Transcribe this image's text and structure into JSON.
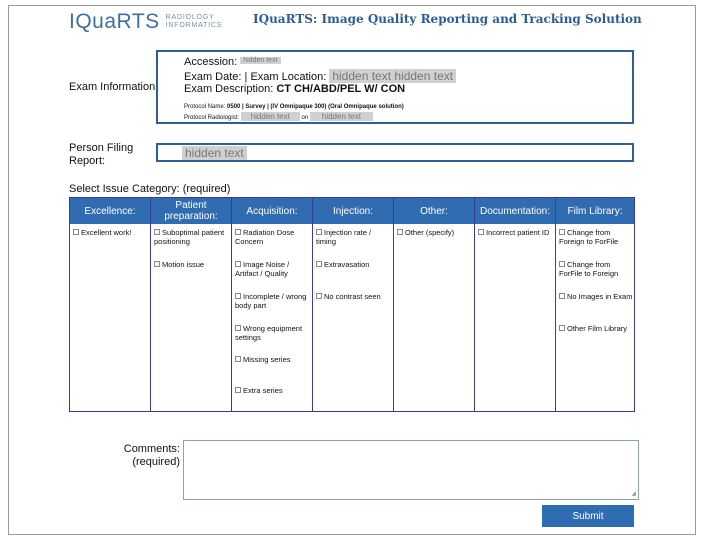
{
  "header": {
    "logo_main": "IQuaRTS",
    "logo_sub_line1": "RADIOLOGY",
    "logo_sub_line2": "INFORMATICS",
    "title": "IQuaRTS: Image Quality Reporting and Tracking Solution"
  },
  "exam": {
    "section_label": "Exam Information:",
    "accession_label": "Accession:",
    "accession_value": "hidden text",
    "exam_date_label": "Exam Date:",
    "exam_location_label": "| Exam Location:",
    "exam_location_value": "hidden text  hidden text",
    "exam_description_label": "Exam Description:",
    "exam_description_value": "CT CH/ABD/PEL W/ CON",
    "protocol_name_label": "Protocol Name:",
    "protocol_name_value": "0500 | Survey | (IV Omnipaque 300) (Oral Omnipaque solution)",
    "protocol_radiologist_label": "Protocol Radiologist:",
    "protocol_radiologist_value": "hidden text",
    "on_label": "on",
    "on_value": "hidden text"
  },
  "person": {
    "label_line1": "Person Filing",
    "label_line2": "Report:",
    "value": "hidden text"
  },
  "issue": {
    "prompt": "Select Issue Category: (required)",
    "columns": [
      {
        "header": "Excellence:",
        "options": [
          "Excellent work!"
        ]
      },
      {
        "header": "Patient preparation:",
        "options": [
          "Suboptimal patient positioning",
          "Motion issue"
        ]
      },
      {
        "header": "Acquisition:",
        "options": [
          "Radiation Dose Concern",
          "Image Noise / Artifact / Quality",
          "Incomplete / wrong body part",
          "Wrong equipment settings",
          "Missing series",
          "Extra series"
        ]
      },
      {
        "header": "Injection:",
        "options": [
          "Injection rate / timing",
          "Extravasation",
          "No contrast seen"
        ]
      },
      {
        "header": "Other:",
        "options": [
          "Other (specify)"
        ]
      },
      {
        "header": "Documentation:",
        "options": [
          "Incorrect patient ID"
        ]
      },
      {
        "header": "Film Library:",
        "options": [
          "Change from Foreign to ForFile",
          "Change from ForFile to Foreign",
          "No Images in Exam",
          "Other Film Library"
        ]
      }
    ]
  },
  "comments": {
    "label_line1": "Comments:",
    "label_line2": "(required)",
    "value": ""
  },
  "submit_label": "Submit",
  "colors": {
    "accent": "#2f6cb2",
    "border": "#2f5f96",
    "title": "#2a5d98"
  }
}
